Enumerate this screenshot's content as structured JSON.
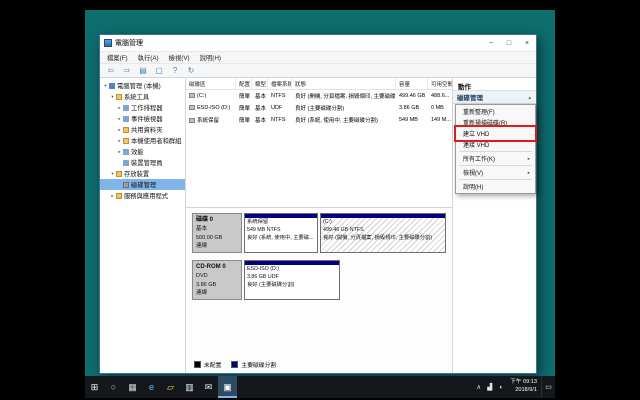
{
  "window": {
    "title": "電腦管理",
    "caption": {
      "minimize": "−",
      "maximize": "□",
      "close": "×"
    },
    "menu": [
      {
        "label": "檔案(F)"
      },
      {
        "label": "執行(A)"
      },
      {
        "label": "檢視(V)"
      },
      {
        "label": "說明(H)"
      }
    ],
    "toolbar_icons": [
      {
        "name": "back-icon",
        "glyph": "⇦"
      },
      {
        "name": "forward-icon",
        "glyph": "⇨"
      },
      {
        "name": "console-tree-icon",
        "glyph": "▤"
      },
      {
        "name": "properties-icon",
        "glyph": "▢"
      },
      {
        "name": "help-icon",
        "glyph": "?"
      },
      {
        "name": "refresh-icon",
        "glyph": "↻"
      }
    ],
    "tree": [
      {
        "label": "電腦管理 (本機)",
        "level": 0,
        "arrow": "▾",
        "icon": "computer-icon"
      },
      {
        "label": "系統工具",
        "level": 1,
        "arrow": "▾",
        "icon": "folder-icon"
      },
      {
        "label": "工作排程器",
        "level": 2,
        "arrow": "▸",
        "icon": "tool-icon"
      },
      {
        "label": "事件檢視器",
        "level": 2,
        "arrow": "▸",
        "icon": "tool-icon"
      },
      {
        "label": "共用資料夾",
        "level": 2,
        "arrow": "▸",
        "icon": "folder-icon"
      },
      {
        "label": "本機使用者和群組",
        "level": 2,
        "arrow": "▸",
        "icon": "folder-icon"
      },
      {
        "label": "效能",
        "level": 2,
        "arrow": "▸",
        "icon": "tool-icon"
      },
      {
        "label": "裝置管理員",
        "level": 2,
        "arrow": "",
        "icon": "tool-icon"
      },
      {
        "label": "存放裝置",
        "level": 1,
        "arrow": "▾",
        "icon": "folder-icon"
      },
      {
        "label": "磁碟管理",
        "level": 2,
        "arrow": "",
        "icon": "disk-icon",
        "selected": true
      },
      {
        "label": "服務與應用程式",
        "level": 1,
        "arrow": "▸",
        "icon": "folder-icon"
      }
    ],
    "volumes": {
      "columns": [
        "磁碟區",
        "配置",
        "類型",
        "檔案系統",
        "狀態",
        "容量",
        "可用空間"
      ],
      "rows": [
        [
          "(C:)",
          "簡單",
          "基本",
          "NTFS",
          "良好 (開機, 分頁檔案, 損毀傾印, 主要磁碟分割)",
          "499.46 GB",
          "488.6..."
        ],
        [
          "ESD-ISO (D:)",
          "簡單",
          "基本",
          "UDF",
          "良好 (主要磁碟分割)",
          "3.86 GB",
          "0 MB"
        ],
        [
          "系統保留",
          "簡單",
          "基本",
          "NTFS",
          "良好 (系統, 使用中, 主要磁碟分割)",
          "549 MB",
          "149 M..."
        ]
      ]
    },
    "disks": [
      {
        "name": "磁碟 0",
        "kind": "基本",
        "size": "500.00 GB",
        "status": "連線",
        "partitions": [
          {
            "title": "系統保留",
            "detail": "549 MB NTFS",
            "status": "良好 (系統, 使用中, 主要磁...",
            "width": 74,
            "hatched": false
          },
          {
            "title": "(C:)",
            "detail": "499.46 GB NTFS",
            "status": "良好 (開機, 分頁檔案, 損毀傾印, 主要磁碟分割)",
            "width": null,
            "hatched": true
          }
        ]
      },
      {
        "name": "CD-ROM 0",
        "kind": "DVD",
        "size": "3.86 GB",
        "status": "連線",
        "partitions": [
          {
            "title": "ESD-ISO (D:)",
            "detail": "3.86 GB UDF",
            "status": "良好 (主要磁碟分割)",
            "width": 96,
            "hatched": false
          }
        ]
      }
    ],
    "legend": [
      {
        "label": "未配置",
        "color": "#000000"
      },
      {
        "label": "主要磁碟分割",
        "color": "#000080"
      }
    ],
    "actions": {
      "title": "動作",
      "section": "磁碟管理",
      "collapse_glyph": "▲"
    },
    "context_menu": {
      "arrow_glyph": "▸",
      "highlight_color": "#e01b1b",
      "items": [
        {
          "label": "重新整理(F)"
        },
        {
          "label": "重新掃描磁碟(R)"
        },
        {
          "label": "建立 VHD",
          "highlighted": true
        },
        {
          "label": "連接 VHD",
          "separator_after": true
        },
        {
          "label": "所有工作(K)",
          "submenu": true,
          "separator_after": true
        },
        {
          "label": "檢視(V)",
          "submenu": true,
          "separator_after": true
        },
        {
          "label": "說明(H)"
        }
      ]
    }
  },
  "taskbar": {
    "icons": [
      {
        "name": "start-button",
        "glyph": "⊞",
        "color": "#ffffff"
      },
      {
        "name": "search-icon",
        "glyph": "○",
        "color": "#cfd8dc"
      },
      {
        "name": "task-view-icon",
        "glyph": "▦",
        "color": "#cfd8dc"
      },
      {
        "name": "edge-icon",
        "glyph": "e",
        "color": "#4fc3f7"
      },
      {
        "name": "file-explorer-icon",
        "glyph": "▱",
        "color": "#ffd54f"
      },
      {
        "name": "store-icon",
        "glyph": "▥",
        "color": "#e1f5fe"
      },
      {
        "name": "mail-icon",
        "glyph": "✉",
        "color": "#e1f5fe"
      },
      {
        "name": "computer-management-icon",
        "glyph": "▣",
        "color": "#ffffff",
        "active": true
      }
    ],
    "tray_icons": [
      {
        "name": "tray-expand-icon",
        "glyph": "∧"
      },
      {
        "name": "network-icon",
        "glyph": "▟"
      },
      {
        "name": "volume-icon",
        "glyph": "◖"
      }
    ],
    "clock_time": "下午 09:13",
    "clock_date": "2018/9/1",
    "action_center_glyph": "▭"
  }
}
